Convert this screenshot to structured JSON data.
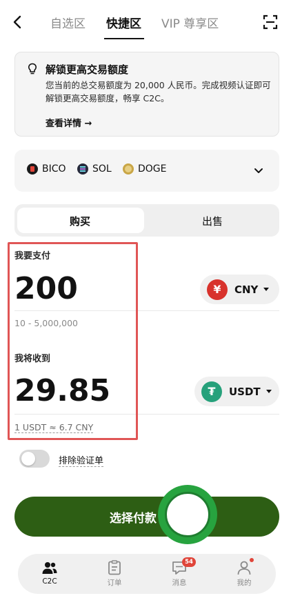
{
  "nav": {
    "tabs": [
      {
        "label": "自选区",
        "active": false
      },
      {
        "label": "快捷区",
        "active": true
      },
      {
        "label": "VIP 尊享区",
        "active": false
      }
    ],
    "back_icon": "chevron-left-icon",
    "scan_icon": "scan-icon"
  },
  "notice": {
    "icon": "lightbulb-icon",
    "title": "解锁更高交易额度",
    "body": "您当前的总交易额度为 20,000 人民币。完成视频认证即可解锁更高交易额度，畅享 C2C。",
    "link": "查看详情 →"
  },
  "coins": {
    "items": [
      {
        "label": "BICO",
        "color": "#1a1a1a"
      },
      {
        "label": "SOL",
        "color": "#262a3b"
      },
      {
        "label": "DOGE",
        "color": "#c9a646"
      }
    ],
    "expand_icon": "chevron-down-icon"
  },
  "segment": {
    "buy": "购买",
    "sell": "出售",
    "active": "buy"
  },
  "pay": {
    "label": "我要支付",
    "amount": "200",
    "currency": "CNY",
    "currency_symbol": "¥",
    "currency_color": "#d8322c",
    "range": "10 - 5,000,000"
  },
  "receive": {
    "label": "我将收到",
    "amount": "29.85",
    "currency": "USDT",
    "currency_symbol": "₮",
    "currency_color": "#26a17b"
  },
  "rate": "1 USDT ≈ 6.7 CNY",
  "exclude_verified": {
    "label": "排除验证单",
    "on": false
  },
  "primary_button": "选择付款",
  "tabbar": {
    "items": [
      {
        "label": "C2C",
        "icon": "users-icon",
        "active": true
      },
      {
        "label": "订单",
        "icon": "clipboard-icon",
        "active": false
      },
      {
        "label": "消息",
        "icon": "chat-icon",
        "active": false,
        "badge": "54"
      },
      {
        "label": "我的",
        "icon": "person-icon",
        "active": false,
        "dot": true
      }
    ]
  },
  "colors": {
    "primary_green": "#2d5e14",
    "floating_green": "#27a33f",
    "highlight_red": "#e05555"
  }
}
